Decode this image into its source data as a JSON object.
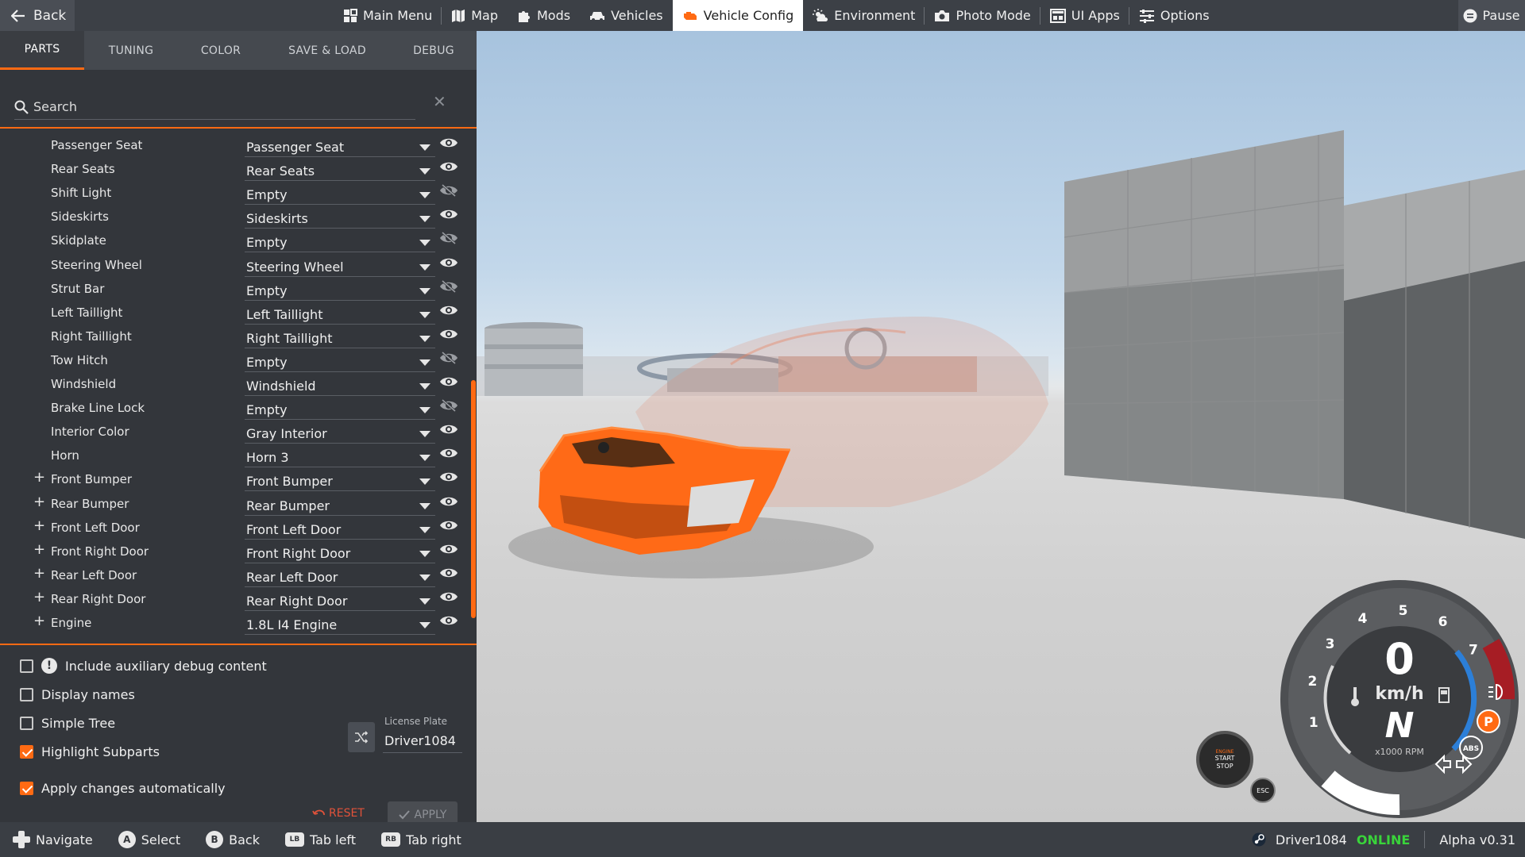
{
  "topbar": {
    "back_label": "Back",
    "pause_label": "Pause",
    "menu": [
      {
        "label": "Main Menu",
        "icon": "grid-icon"
      },
      {
        "label": "Map",
        "icon": "map-icon"
      },
      {
        "label": "Mods",
        "icon": "puzzle-icon"
      },
      {
        "label": "Vehicles",
        "icon": "car-icon"
      },
      {
        "label": "Vehicle Config",
        "icon": "engine-icon",
        "active": true
      },
      {
        "label": "Environment",
        "icon": "weather-icon"
      },
      {
        "label": "Photo Mode",
        "icon": "camera-icon"
      },
      {
        "label": "UI Apps",
        "icon": "apps-icon"
      },
      {
        "label": "Options",
        "icon": "sliders-icon"
      }
    ]
  },
  "panel": {
    "tabs": [
      {
        "label": "PARTS",
        "active": true
      },
      {
        "label": "TUNING"
      },
      {
        "label": "COLOR"
      },
      {
        "label": "SAVE & LOAD"
      },
      {
        "label": "DEBUG"
      }
    ],
    "search_placeholder": "Search",
    "parts": [
      {
        "name": "Passenger Seat",
        "value": "Passenger Seat",
        "visible": true,
        "expandable": false
      },
      {
        "name": "Rear Seats",
        "value": "Rear Seats",
        "visible": true,
        "expandable": false
      },
      {
        "name": "Shift Light",
        "value": "Empty",
        "visible": false,
        "expandable": false
      },
      {
        "name": "Sideskirts",
        "value": "Sideskirts",
        "visible": true,
        "expandable": false
      },
      {
        "name": "Skidplate",
        "value": "Empty",
        "visible": false,
        "expandable": false
      },
      {
        "name": "Steering Wheel",
        "value": "Steering Wheel",
        "visible": true,
        "expandable": false
      },
      {
        "name": "Strut Bar",
        "value": "Empty",
        "visible": false,
        "expandable": false
      },
      {
        "name": "Left Taillight",
        "value": "Left Taillight",
        "visible": true,
        "expandable": false
      },
      {
        "name": "Right Taillight",
        "value": "Right Taillight",
        "visible": true,
        "expandable": false
      },
      {
        "name": "Tow Hitch",
        "value": "Empty",
        "visible": false,
        "expandable": false
      },
      {
        "name": "Windshield",
        "value": "Windshield",
        "visible": true,
        "expandable": false
      },
      {
        "name": "Brake Line Lock",
        "value": "Empty",
        "visible": false,
        "expandable": false
      },
      {
        "name": "Interior Color",
        "value": "Gray Interior",
        "visible": true,
        "expandable": false
      },
      {
        "name": "Horn",
        "value": "Horn 3",
        "visible": true,
        "expandable": false
      },
      {
        "name": "Front Bumper",
        "value": "Front Bumper",
        "visible": true,
        "expandable": true
      },
      {
        "name": "Rear Bumper",
        "value": "Rear Bumper",
        "visible": true,
        "expandable": true
      },
      {
        "name": "Front Left Door",
        "value": "Front Left Door",
        "visible": true,
        "expandable": true
      },
      {
        "name": "Front Right Door",
        "value": "Front Right Door",
        "visible": true,
        "expandable": true
      },
      {
        "name": "Rear Left Door",
        "value": "Rear Left Door",
        "visible": true,
        "expandable": true
      },
      {
        "name": "Rear Right Door",
        "value": "Rear Right Door",
        "visible": true,
        "expandable": true
      },
      {
        "name": "Engine",
        "value": "1.8L I4 Engine",
        "visible": true,
        "expandable": true
      }
    ],
    "options": {
      "aux_debug": {
        "label": "Include auxiliary debug content",
        "checked": false
      },
      "display_names": {
        "label": "Display names",
        "checked": false
      },
      "simple_tree": {
        "label": "Simple Tree",
        "checked": false
      },
      "highlight_subparts": {
        "label": "Highlight Subparts",
        "checked": true
      },
      "apply_auto": {
        "label": "Apply changes automatically",
        "checked": true
      }
    },
    "license_plate": {
      "label": "License Plate",
      "value": "Driver1084"
    },
    "reset_label": "RESET",
    "apply_label": "APPLY"
  },
  "hud": {
    "speed": "0",
    "unit": "km/h",
    "gear": "N",
    "rpm_label": "x1000 RPM",
    "rpm_ticks": [
      "1",
      "2",
      "3",
      "4",
      "5",
      "6",
      "7"
    ],
    "abs_label": "ABS",
    "parking_label": "P",
    "engine_button": {
      "top": "ENGINE",
      "line1": "START",
      "line2": "STOP"
    },
    "esc_label": "ESC"
  },
  "bottombar": {
    "hints": [
      {
        "glyph": "dpad",
        "label": "Navigate"
      },
      {
        "glyph": "A",
        "label": "Select"
      },
      {
        "glyph": "B",
        "label": "Back"
      },
      {
        "glyph": "LB",
        "label": "Tab left"
      },
      {
        "glyph": "RB",
        "label": "Tab right"
      }
    ],
    "username": "Driver1084",
    "status": "ONLINE",
    "version": "Alpha v0.31"
  },
  "colors": {
    "accent": "#ff6a13",
    "online": "#39d43a",
    "reset": "#e0523a"
  }
}
